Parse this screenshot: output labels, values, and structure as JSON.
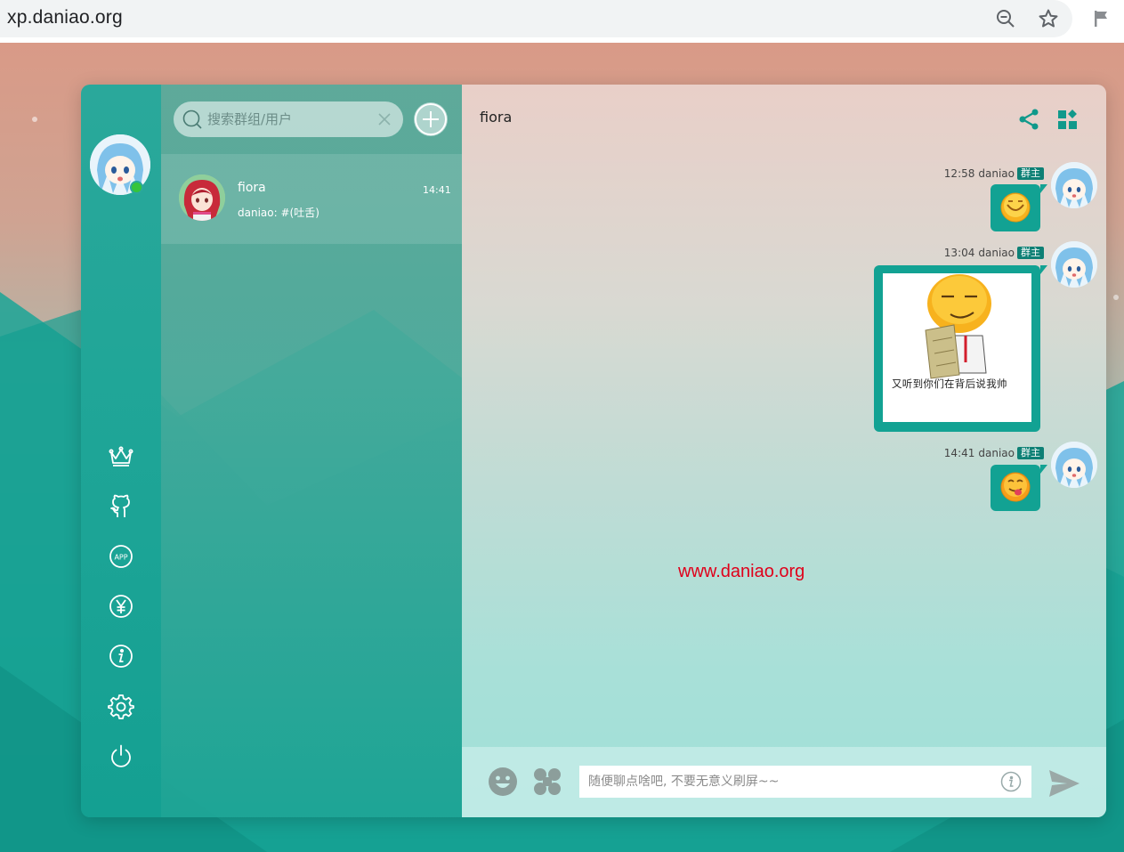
{
  "browser": {
    "url": "xp.daniao.org",
    "icons": [
      "zoom-out-icon",
      "bookmark-star-icon",
      "flag-icon"
    ]
  },
  "search": {
    "placeholder": "搜索群组/用户"
  },
  "conversation": {
    "name": "fiora",
    "time": "14:41",
    "preview": "daniao: #(吐舌)"
  },
  "chat": {
    "title": "fiora",
    "messages": [
      {
        "time": "12:58",
        "user": "daniao",
        "badge": "群主",
        "content": "emoji-smile"
      },
      {
        "time": "13:04",
        "user": "daniao",
        "badge": "群主",
        "content": "image",
        "caption": "又听到你们在背后说我帅"
      },
      {
        "time": "14:41",
        "user": "daniao",
        "badge": "群主",
        "content": "emoji-tongue"
      }
    ]
  },
  "watermark": "www.daniao.org",
  "composer": {
    "placeholder": "随便聊点啥吧, 不要无意义刷屏~~"
  },
  "sidebar": {
    "icons": [
      "crown-icon",
      "github-icon",
      "app-icon",
      "yen-icon",
      "info-icon",
      "gear-icon",
      "power-icon"
    ]
  },
  "colors": {
    "accent": "#12a293",
    "badge": "#0d8075",
    "online": "#35c53b",
    "watermark": "#e0001a"
  }
}
